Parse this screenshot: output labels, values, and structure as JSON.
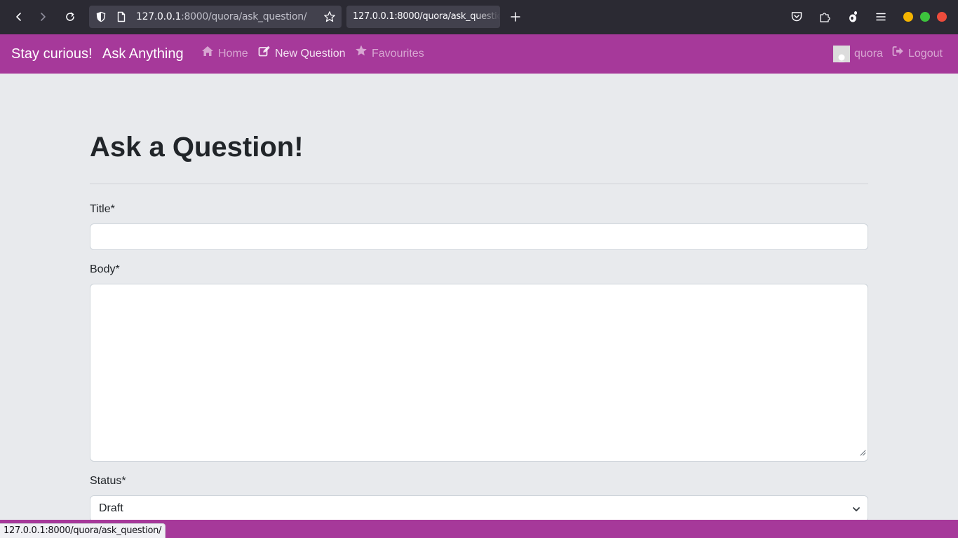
{
  "browser": {
    "url_host": "127.0.0.1",
    "url_rest": ":8000/quora/ask_question/",
    "tab_title": "127.0.0.1:8000/quora/ask_question/",
    "status_url": "127.0.0.1:8000/quora/ask_question/",
    "window_controls": [
      "minimize",
      "maximize",
      "close"
    ]
  },
  "navbar": {
    "brand": "Stay curious!",
    "brand2": "Ask Anything",
    "links": [
      {
        "label": "Home",
        "icon": "home-icon"
      },
      {
        "label": "New Question",
        "icon": "edit-icon"
      },
      {
        "label": "Favourites",
        "icon": "star-icon"
      }
    ],
    "user": {
      "name": "quora",
      "icon": "avatar"
    },
    "logout": {
      "label": "Logout",
      "icon": "logout-icon"
    }
  },
  "form": {
    "heading": "Ask a Question!",
    "title_label": "Title*",
    "title_value": "",
    "body_label": "Body*",
    "body_value": "",
    "status_label": "Status*",
    "status_value": "Draft"
  },
  "colors": {
    "navbar": "#a6399a",
    "background": "#e8eaed",
    "chrome": "#2b2a33"
  }
}
